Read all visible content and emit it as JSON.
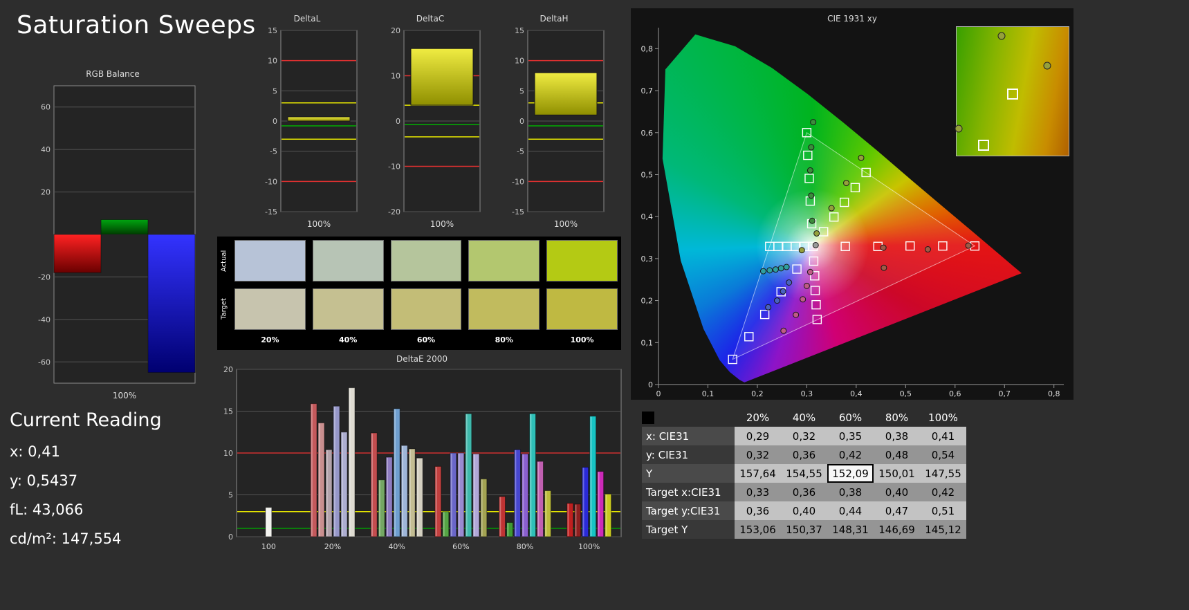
{
  "page": {
    "title": "Saturation Sweeps"
  },
  "current_reading": {
    "title": "Current Reading",
    "lines": [
      "x: 0,41",
      "y: 0,5437",
      "fL: 43,066",
      "cd/m²: 147,554"
    ]
  },
  "swatches": {
    "row_labels": [
      "Actual",
      "Target"
    ],
    "col_labels": [
      "20%",
      "40%",
      "60%",
      "80%",
      "100%"
    ],
    "actual": [
      "#b7c3d7",
      "#b7c4b5",
      "#b5c59c",
      "#b3c76f",
      "#b4ca14"
    ],
    "target": [
      "#c7c4ae",
      "#c5c091",
      "#c3bd77",
      "#c1bb5e",
      "#bfb942"
    ]
  },
  "table": {
    "col_headers": [
      "20%",
      "40%",
      "60%",
      "80%",
      "100%"
    ],
    "rows": [
      {
        "label": "x: CIE31",
        "values": [
          "0,29",
          "0,32",
          "0,35",
          "0,38",
          "0,41"
        ]
      },
      {
        "label": "y: CIE31",
        "values": [
          "0,32",
          "0,36",
          "0,42",
          "0,48",
          "0,54"
        ]
      },
      {
        "label": "Y",
        "values": [
          "157,64",
          "154,55",
          "152,09",
          "150,01",
          "147,55"
        ]
      },
      {
        "label": "Target x:CIE31",
        "values": [
          "0,33",
          "0,36",
          "0,38",
          "0,40",
          "0,42"
        ]
      },
      {
        "label": "Target y:CIE31",
        "values": [
          "0,36",
          "0,40",
          "0,44",
          "0,47",
          "0,51"
        ]
      },
      {
        "label": "Target Y",
        "values": [
          "153,06",
          "150,37",
          "148,31",
          "146,69",
          "145,12"
        ]
      }
    ],
    "highlight": {
      "row": 2,
      "col": 2
    }
  },
  "chart_data": [
    {
      "id": "rgb-balance",
      "type": "bar",
      "title": "RGB Balance",
      "xlabel": "100%",
      "ylim": [
        -70,
        70
      ],
      "yticks": [
        60,
        40,
        20,
        -20,
        -40,
        -60
      ],
      "zero_line": true,
      "categories": [
        "red",
        "green",
        "blue"
      ],
      "values": [
        -18,
        7,
        -65
      ],
      "colors": [
        [
          "#ff2222",
          "#6a0000"
        ],
        [
          "#00a510",
          "#003c00"
        ],
        [
          "#3333ff",
          "#000070"
        ]
      ]
    },
    {
      "id": "delta-l",
      "type": "bar",
      "title": "DeltaL",
      "xlabel": "100%",
      "ylim": [
        -15,
        15
      ],
      "yticks": [
        15,
        10,
        5,
        0,
        -5,
        -10,
        -15
      ],
      "bar_from": 0,
      "bar_to": 0.7,
      "ref_lines": [
        {
          "y": 10,
          "color": "#e03030"
        },
        {
          "y": -10,
          "color": "#e03030"
        },
        {
          "y": 3,
          "color": "#e8e800"
        },
        {
          "y": -3,
          "color": "#e8e800"
        },
        {
          "y": -0.8,
          "color": "#00b000"
        }
      ]
    },
    {
      "id": "delta-c",
      "type": "bar",
      "title": "DeltaC",
      "xlabel": "100%",
      "ylim": [
        -20,
        20
      ],
      "yticks": [
        20,
        10,
        0,
        -10,
        -20
      ],
      "bar_from": 3.5,
      "bar_to": 16,
      "ref_lines": [
        {
          "y": 10,
          "color": "#e03030"
        },
        {
          "y": -10,
          "color": "#e03030"
        },
        {
          "y": 3.5,
          "color": "#e8e800"
        },
        {
          "y": -3.5,
          "color": "#e8e800"
        },
        {
          "y": -0.8,
          "color": "#00b000"
        }
      ]
    },
    {
      "id": "delta-h",
      "type": "bar",
      "title": "DeltaH",
      "xlabel": "100%",
      "ylim": [
        -15,
        15
      ],
      "yticks": [
        15,
        10,
        5,
        0,
        -5,
        -10,
        -15
      ],
      "bar_from": 1,
      "bar_to": 8,
      "ref_lines": [
        {
          "y": 10,
          "color": "#e03030"
        },
        {
          "y": -10,
          "color": "#e03030"
        },
        {
          "y": 3,
          "color": "#e8e800"
        },
        {
          "y": -3,
          "color": "#e8e800"
        },
        {
          "y": -0.8,
          "color": "#00b000"
        }
      ]
    },
    {
      "id": "deltae-2000",
      "type": "bar",
      "title": "DeltaE 2000",
      "ylim": [
        0,
        20
      ],
      "yticks": [
        20,
        15,
        10,
        5,
        0
      ],
      "ref_lines": [
        {
          "y": 10,
          "color": "#d03030"
        },
        {
          "y": 3,
          "color": "#e8e800"
        },
        {
          "y": 1,
          "color": "#00a000"
        }
      ],
      "groups": [
        {
          "label": "100",
          "bars": [
            {
              "v": 3.5,
              "c": "#f2f2ee"
            }
          ]
        },
        {
          "label": "20%",
          "bars": [
            {
              "v": 15.9,
              "c": "#c4595c"
            },
            {
              "v": 13.6,
              "c": "#c98f8f"
            },
            {
              "v": 10.4,
              "c": "#b3a3ab"
            },
            {
              "v": 15.6,
              "c": "#9697c9"
            },
            {
              "v": 12.5,
              "c": "#adaed0"
            },
            {
              "v": 17.8,
              "c": "#dfdcd2"
            }
          ]
        },
        {
          "label": "40%",
          "bars": [
            {
              "v": 12.4,
              "c": "#c44d4f"
            },
            {
              "v": 6.8,
              "c": "#74a763"
            },
            {
              "v": 9.5,
              "c": "#8f7cc1"
            },
            {
              "v": 15.3,
              "c": "#6f9fd0"
            },
            {
              "v": 10.9,
              "c": "#9fb6d8"
            },
            {
              "v": 10.5,
              "c": "#c3bd93"
            },
            {
              "v": 9.4,
              "c": "#d3cfc0"
            }
          ]
        },
        {
          "label": "60%",
          "bars": [
            {
              "v": 8.4,
              "c": "#c2403f"
            },
            {
              "v": 3.0,
              "c": "#55a545"
            },
            {
              "v": 10.0,
              "c": "#6a66c8"
            },
            {
              "v": 10.0,
              "c": "#9a8ad0"
            },
            {
              "v": 14.7,
              "c": "#3fb9ac"
            },
            {
              "v": 9.9,
              "c": "#b0a7d8"
            },
            {
              "v": 6.9,
              "c": "#a3a353"
            }
          ]
        },
        {
          "label": "80%",
          "bars": [
            {
              "v": 4.8,
              "c": "#bf3333"
            },
            {
              "v": 1.7,
              "c": "#3f9a33"
            },
            {
              "v": 10.4,
              "c": "#4747cf"
            },
            {
              "v": 9.9,
              "c": "#8a5fd0"
            },
            {
              "v": 14.7,
              "c": "#2fc0b8"
            },
            {
              "v": 9.0,
              "c": "#c05fb0"
            },
            {
              "v": 5.5,
              "c": "#bcbc3c"
            }
          ]
        },
        {
          "label": "100%",
          "bars": [
            {
              "v": 4.0,
              "c": "#c01f1f"
            },
            {
              "v": 3.9,
              "c": "#8f1f1f"
            },
            {
              "v": 8.3,
              "c": "#2a2ad8"
            },
            {
              "v": 14.4,
              "c": "#17c4c4"
            },
            {
              "v": 7.8,
              "c": "#cc2ab8"
            },
            {
              "v": 5.1,
              "c": "#c8c81f"
            }
          ]
        }
      ]
    },
    {
      "id": "cie-1931",
      "type": "scatter",
      "title": "CIE 1931 xy",
      "xlim": [
        0,
        0.82
      ],
      "ylim": [
        0,
        0.85
      ],
      "xtick_labels": [
        "0",
        "0,1",
        "0,2",
        "0,3",
        "0,4",
        "0,5",
        "0,6",
        "0,7",
        "0,8"
      ],
      "ytick_labels": [
        "0",
        "0,1",
        "0,2",
        "0,3",
        "0,4",
        "0,5",
        "0,6",
        "0,7",
        "0,8"
      ],
      "rgb_triangle": [
        [
          0.64,
          0.33
        ],
        [
          0.3,
          0.6
        ],
        [
          0.15,
          0.06
        ]
      ],
      "white_point": [
        0.3127,
        0.329
      ],
      "targets": [
        [
          0.3127,
          0.329
        ],
        [
          0.334,
          0.364
        ],
        [
          0.355,
          0.399
        ],
        [
          0.376,
          0.434
        ],
        [
          0.398,
          0.469
        ],
        [
          0.42,
          0.505
        ],
        [
          0.31,
          0.383
        ],
        [
          0.307,
          0.437
        ],
        [
          0.305,
          0.491
        ],
        [
          0.302,
          0.546
        ],
        [
          0.3,
          0.6
        ],
        [
          0.295,
          0.329
        ],
        [
          0.277,
          0.329
        ],
        [
          0.26,
          0.329
        ],
        [
          0.242,
          0.329
        ],
        [
          0.225,
          0.329
        ],
        [
          0.378,
          0.329
        ],
        [
          0.444,
          0.329
        ],
        [
          0.509,
          0.33
        ],
        [
          0.575,
          0.33
        ],
        [
          0.64,
          0.33
        ],
        [
          0.314,
          0.294
        ],
        [
          0.316,
          0.259
        ],
        [
          0.317,
          0.224
        ],
        [
          0.319,
          0.19
        ],
        [
          0.321,
          0.155
        ],
        [
          0.28,
          0.275
        ],
        [
          0.248,
          0.221
        ],
        [
          0.215,
          0.167
        ],
        [
          0.183,
          0.114
        ],
        [
          0.15,
          0.06
        ]
      ],
      "measurements": [
        {
          "x": 0.29,
          "y": 0.32,
          "c": "#95a03c"
        },
        {
          "x": 0.32,
          "y": 0.36,
          "c": "#95a03c"
        },
        {
          "x": 0.35,
          "y": 0.42,
          "c": "#95a03c"
        },
        {
          "x": 0.38,
          "y": 0.48,
          "c": "#95a03c"
        },
        {
          "x": 0.41,
          "y": 0.54,
          "c": "#95a03c"
        },
        {
          "x": 0.311,
          "y": 0.39,
          "c": "#3c8c3c"
        },
        {
          "x": 0.309,
          "y": 0.45,
          "c": "#3c8c3c"
        },
        {
          "x": 0.307,
          "y": 0.51,
          "c": "#3c8c3c"
        },
        {
          "x": 0.309,
          "y": 0.565,
          "c": "#3c8c3c"
        },
        {
          "x": 0.313,
          "y": 0.625,
          "c": "#3c8c3c"
        },
        {
          "x": 0.212,
          "y": 0.27,
          "c": "#2fa0a0"
        },
        {
          "x": 0.225,
          "y": 0.272,
          "c": "#2fa0a0"
        },
        {
          "x": 0.237,
          "y": 0.274,
          "c": "#2fa0a0"
        },
        {
          "x": 0.248,
          "y": 0.277,
          "c": "#2fa0a0"
        },
        {
          "x": 0.259,
          "y": 0.28,
          "c": "#2fa0a0"
        },
        {
          "x": 0.456,
          "y": 0.278,
          "c": "#a05a46"
        },
        {
          "x": 0.455,
          "y": 0.326,
          "c": "#a05a46"
        },
        {
          "x": 0.545,
          "y": 0.322,
          "c": "#a05a46"
        },
        {
          "x": 0.627,
          "y": 0.331,
          "c": "#a05a46"
        },
        {
          "x": 0.307,
          "y": 0.268,
          "c": "#c05a86"
        },
        {
          "x": 0.3,
          "y": 0.235,
          "c": "#c05a86"
        },
        {
          "x": 0.292,
          "y": 0.203,
          "c": "#c05a86"
        },
        {
          "x": 0.278,
          "y": 0.166,
          "c": "#c05a86"
        },
        {
          "x": 0.253,
          "y": 0.128,
          "c": "#c05a86"
        },
        {
          "x": 0.264,
          "y": 0.243,
          "c": "#4a62c0"
        },
        {
          "x": 0.252,
          "y": 0.222,
          "c": "#4a62c0"
        },
        {
          "x": 0.24,
          "y": 0.2,
          "c": "#4a62c0"
        },
        {
          "x": 0.222,
          "y": 0.184,
          "c": "#4a62c0"
        },
        {
          "x": 0.318,
          "y": 0.332,
          "c": "#9a9a9a"
        }
      ],
      "inset": {
        "squares": [
          [
            0.5,
            0.52
          ],
          [
            0.24,
            0.92
          ]
        ],
        "circles": [
          [
            0.4,
            0.07
          ],
          [
            0.02,
            0.79
          ],
          [
            0.81,
            0.3
          ]
        ],
        "marker_color": "#95a03c"
      }
    }
  ]
}
